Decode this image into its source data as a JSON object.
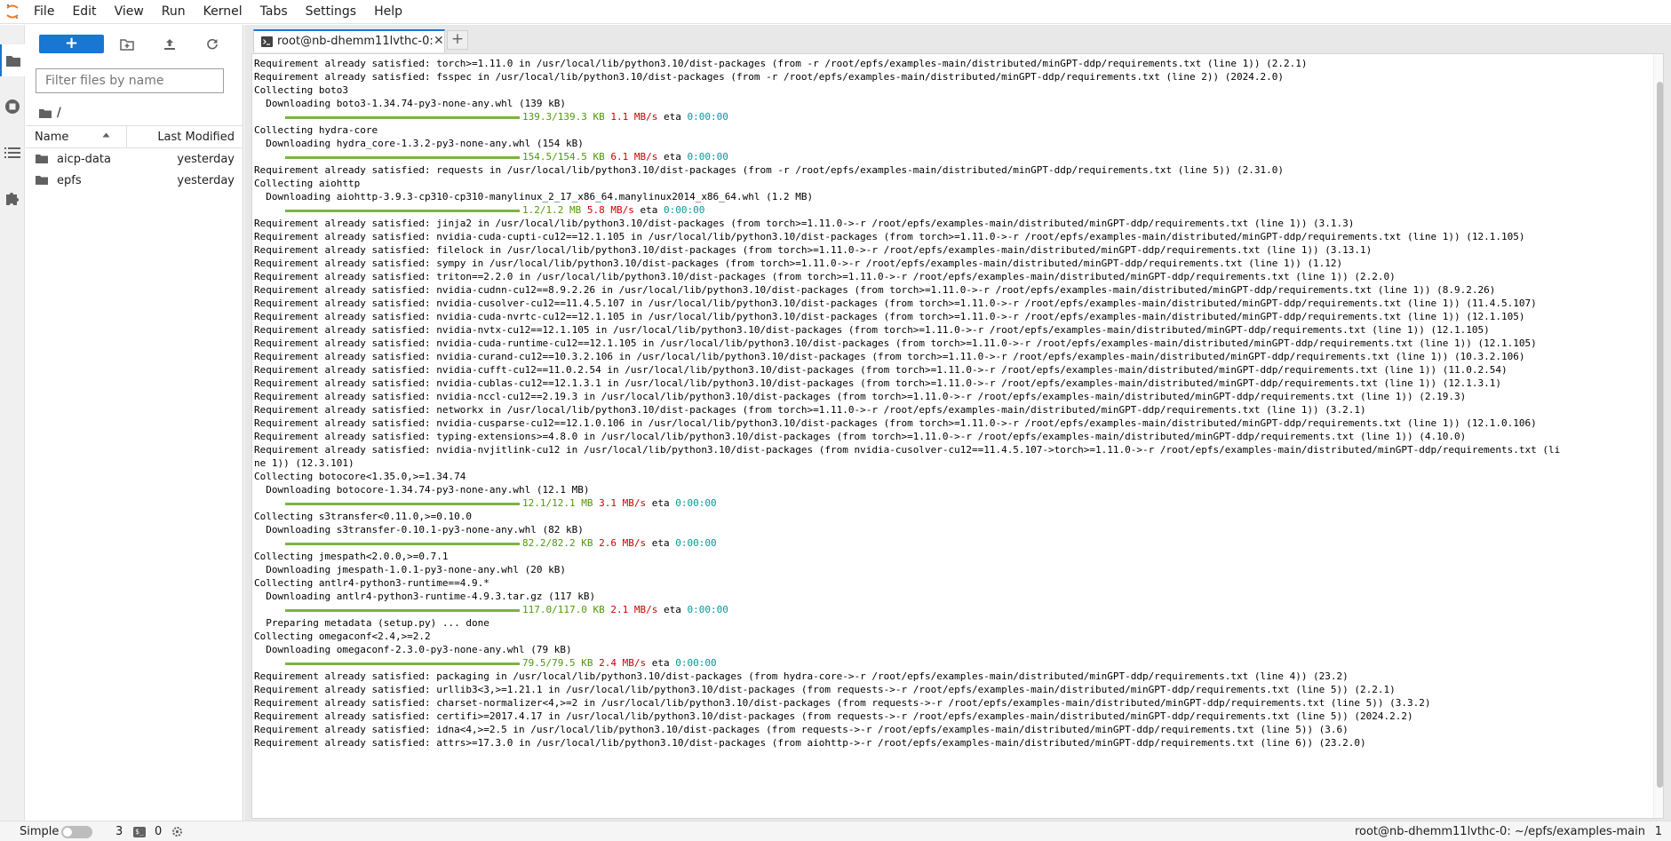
{
  "menu": [
    "File",
    "Edit",
    "View",
    "Run",
    "Kernel",
    "Tabs",
    "Settings",
    "Help"
  ],
  "sidebar": {
    "filter_placeholder": "Filter files by name",
    "breadcrumb": "/",
    "columns": {
      "name": "Name",
      "modified": "Last Modified"
    },
    "files": [
      {
        "name": "aicp-data",
        "modified": "yesterday"
      },
      {
        "name": "epfs",
        "modified": "yesterday"
      }
    ]
  },
  "tab": {
    "label": "root@nb-dhemm11lvthc-0:"
  },
  "terminal": {
    "lines": [
      {
        "text": "Requirement already satisfied: torch>=1.11.0 in /usr/local/lib/python3.10/dist-packages (from -r /root/epfs/examples-main/distributed/minGPT-ddp/requirements.txt (line 1)) (2.2.1)"
      },
      {
        "text": "Requirement already satisfied: fsspec in /usr/local/lib/python3.10/dist-packages (from -r /root/epfs/examples-main/distributed/minGPT-ddp/requirements.txt (line 2)) (2024.2.0)"
      },
      {
        "text": "Collecting boto3"
      },
      {
        "text": "  Downloading boto3-1.34.74-py3-none-any.whl (139 kB)"
      },
      {
        "progress": true,
        "done": "139.3/139.3 KB",
        "speed": "1.1 MB/s",
        "eta_label": "eta",
        "eta": "0:00:00"
      },
      {
        "text": "Collecting hydra-core"
      },
      {
        "text": "  Downloading hydra_core-1.3.2-py3-none-any.whl (154 kB)"
      },
      {
        "progress": true,
        "done": "154.5/154.5 KB",
        "speed": "6.1 MB/s",
        "eta_label": "eta",
        "eta": "0:00:00"
      },
      {
        "text": "Requirement already satisfied: requests in /usr/local/lib/python3.10/dist-packages (from -r /root/epfs/examples-main/distributed/minGPT-ddp/requirements.txt (line 5)) (2.31.0)"
      },
      {
        "text": "Collecting aiohttp"
      },
      {
        "text": "  Downloading aiohttp-3.9.3-cp310-cp310-manylinux_2_17_x86_64.manylinux2014_x86_64.whl (1.2 MB)"
      },
      {
        "progress": true,
        "done": "1.2/1.2 MB",
        "speed": "5.8 MB/s",
        "eta_label": "eta",
        "eta": "0:00:00"
      },
      {
        "text": "Requirement already satisfied: jinja2 in /usr/local/lib/python3.10/dist-packages (from torch>=1.11.0->-r /root/epfs/examples-main/distributed/minGPT-ddp/requirements.txt (line 1)) (3.1.3)"
      },
      {
        "text": "Requirement already satisfied: nvidia-cuda-cupti-cu12==12.1.105 in /usr/local/lib/python3.10/dist-packages (from torch>=1.11.0->-r /root/epfs/examples-main/distributed/minGPT-ddp/requirements.txt (line 1)) (12.1.105)"
      },
      {
        "text": "Requirement already satisfied: filelock in /usr/local/lib/python3.10/dist-packages (from torch>=1.11.0->-r /root/epfs/examples-main/distributed/minGPT-ddp/requirements.txt (line 1)) (3.13.1)"
      },
      {
        "text": "Requirement already satisfied: sympy in /usr/local/lib/python3.10/dist-packages (from torch>=1.11.0->-r /root/epfs/examples-main/distributed/minGPT-ddp/requirements.txt (line 1)) (1.12)"
      },
      {
        "text": "Requirement already satisfied: triton==2.2.0 in /usr/local/lib/python3.10/dist-packages (from torch>=1.11.0->-r /root/epfs/examples-main/distributed/minGPT-ddp/requirements.txt (line 1)) (2.2.0)"
      },
      {
        "text": "Requirement already satisfied: nvidia-cudnn-cu12==8.9.2.26 in /usr/local/lib/python3.10/dist-packages (from torch>=1.11.0->-r /root/epfs/examples-main/distributed/minGPT-ddp/requirements.txt (line 1)) (8.9.2.26)"
      },
      {
        "text": "Requirement already satisfied: nvidia-cusolver-cu12==11.4.5.107 in /usr/local/lib/python3.10/dist-packages (from torch>=1.11.0->-r /root/epfs/examples-main/distributed/minGPT-ddp/requirements.txt (line 1)) (11.4.5.107)"
      },
      {
        "text": "Requirement already satisfied: nvidia-cuda-nvrtc-cu12==12.1.105 in /usr/local/lib/python3.10/dist-packages (from torch>=1.11.0->-r /root/epfs/examples-main/distributed/minGPT-ddp/requirements.txt (line 1)) (12.1.105)"
      },
      {
        "text": "Requirement already satisfied: nvidia-nvtx-cu12==12.1.105 in /usr/local/lib/python3.10/dist-packages (from torch>=1.11.0->-r /root/epfs/examples-main/distributed/minGPT-ddp/requirements.txt (line 1)) (12.1.105)"
      },
      {
        "text": "Requirement already satisfied: nvidia-cuda-runtime-cu12==12.1.105 in /usr/local/lib/python3.10/dist-packages (from torch>=1.11.0->-r /root/epfs/examples-main/distributed/minGPT-ddp/requirements.txt (line 1)) (12.1.105)"
      },
      {
        "text": "Requirement already satisfied: nvidia-curand-cu12==10.3.2.106 in /usr/local/lib/python3.10/dist-packages (from torch>=1.11.0->-r /root/epfs/examples-main/distributed/minGPT-ddp/requirements.txt (line 1)) (10.3.2.106)"
      },
      {
        "text": "Requirement already satisfied: nvidia-cufft-cu12==11.0.2.54 in /usr/local/lib/python3.10/dist-packages (from torch>=1.11.0->-r /root/epfs/examples-main/distributed/minGPT-ddp/requirements.txt (line 1)) (11.0.2.54)"
      },
      {
        "text": "Requirement already satisfied: nvidia-cublas-cu12==12.1.3.1 in /usr/local/lib/python3.10/dist-packages (from torch>=1.11.0->-r /root/epfs/examples-main/distributed/minGPT-ddp/requirements.txt (line 1)) (12.1.3.1)"
      },
      {
        "text": "Requirement already satisfied: nvidia-nccl-cu12==2.19.3 in /usr/local/lib/python3.10/dist-packages (from torch>=1.11.0->-r /root/epfs/examples-main/distributed/minGPT-ddp/requirements.txt (line 1)) (2.19.3)"
      },
      {
        "text": "Requirement already satisfied: networkx in /usr/local/lib/python3.10/dist-packages (from torch>=1.11.0->-r /root/epfs/examples-main/distributed/minGPT-ddp/requirements.txt (line 1)) (3.2.1)"
      },
      {
        "text": "Requirement already satisfied: nvidia-cusparse-cu12==12.1.0.106 in /usr/local/lib/python3.10/dist-packages (from torch>=1.11.0->-r /root/epfs/examples-main/distributed/minGPT-ddp/requirements.txt (line 1)) (12.1.0.106)"
      },
      {
        "text": "Requirement already satisfied: typing-extensions>=4.8.0 in /usr/local/lib/python3.10/dist-packages (from torch>=1.11.0->-r /root/epfs/examples-main/distributed/minGPT-ddp/requirements.txt (line 1)) (4.10.0)"
      },
      {
        "text": "Requirement already satisfied: nvidia-nvjitlink-cu12 in /usr/local/lib/python3.10/dist-packages (from nvidia-cusolver-cu12==11.4.5.107->torch>=1.11.0->-r /root/epfs/examples-main/distributed/minGPT-ddp/requirements.txt (li"
      },
      {
        "text": "ne 1)) (12.3.101)"
      },
      {
        "text": "Collecting botocore<1.35.0,>=1.34.74"
      },
      {
        "text": "  Downloading botocore-1.34.74-py3-none-any.whl (12.1 MB)"
      },
      {
        "progress": true,
        "done": "12.1/12.1 MB",
        "speed": "3.1 MB/s",
        "eta_label": "eta",
        "eta": "0:00:00"
      },
      {
        "text": "Collecting s3transfer<0.11.0,>=0.10.0"
      },
      {
        "text": "  Downloading s3transfer-0.10.1-py3-none-any.whl (82 kB)"
      },
      {
        "progress": true,
        "done": "82.2/82.2 KB",
        "speed": "2.6 MB/s",
        "eta_label": "eta",
        "eta": "0:00:00"
      },
      {
        "text": "Collecting jmespath<2.0.0,>=0.7.1"
      },
      {
        "text": "  Downloading jmespath-1.0.1-py3-none-any.whl (20 kB)"
      },
      {
        "text": "Collecting antlr4-python3-runtime==4.9.*"
      },
      {
        "text": "  Downloading antlr4-python3-runtime-4.9.3.tar.gz (117 kB)"
      },
      {
        "progress": true,
        "done": "117.0/117.0 KB",
        "speed": "2.1 MB/s",
        "eta_label": "eta",
        "eta": "0:00:00"
      },
      {
        "text": "  Preparing metadata (setup.py) ... done"
      },
      {
        "text": "Collecting omegaconf<2.4,>=2.2"
      },
      {
        "text": "  Downloading omegaconf-2.3.0-py3-none-any.whl (79 kB)"
      },
      {
        "progress": true,
        "done": "79.5/79.5 KB",
        "speed": "2.4 MB/s",
        "eta_label": "eta",
        "eta": "0:00:00"
      },
      {
        "text": "Requirement already satisfied: packaging in /usr/local/lib/python3.10/dist-packages (from hydra-core->-r /root/epfs/examples-main/distributed/minGPT-ddp/requirements.txt (line 4)) (23.2)"
      },
      {
        "text": "Requirement already satisfied: urllib3<3,>=1.21.1 in /usr/local/lib/python3.10/dist-packages (from requests->-r /root/epfs/examples-main/distributed/minGPT-ddp/requirements.txt (line 5)) (2.2.1)"
      },
      {
        "text": "Requirement already satisfied: charset-normalizer<4,>=2 in /usr/local/lib/python3.10/dist-packages (from requests->-r /root/epfs/examples-main/distributed/minGPT-ddp/requirements.txt (line 5)) (3.3.2)"
      },
      {
        "text": "Requirement already satisfied: certifi>=2017.4.17 in /usr/local/lib/python3.10/dist-packages (from requests->-r /root/epfs/examples-main/distributed/minGPT-ddp/requirements.txt (line 5)) (2024.2.2)"
      },
      {
        "text": "Requirement already satisfied: idna<4,>=2.5 in /usr/local/lib/python3.10/dist-packages (from requests->-r /root/epfs/examples-main/distributed/minGPT-ddp/requirements.txt (line 5)) (3.6)"
      },
      {
        "text": "Requirement already satisfied: attrs>=17.3.0 in /usr/local/lib/python3.10/dist-packages (from aiohttp->-r /root/epfs/examples-main/distributed/minGPT-ddp/requirements.txt (line 6)) (23.2.0)"
      }
    ]
  },
  "statusbar": {
    "mode": "Simple",
    "simple_mode_on": false,
    "terminals": "3",
    "terminal_icon_text": "$_",
    "kernels": "0",
    "path": "root@nb-dhemm11lvthc-0: ~/epfs/examples-main",
    "line": "1"
  },
  "colors": {
    "accent": "#1976d2",
    "progress_bar": "#7cb342",
    "progress_done": "#4e9a06",
    "progress_speed": "#cc0000",
    "progress_eta": "#06989a",
    "folder_icon": "#616161"
  },
  "icons": {
    "logo": "jupyter-logo-icon",
    "activity": [
      "folder-icon",
      "stop-circle-icon",
      "list-icon",
      "puzzle-icon"
    ],
    "toolbar": [
      "plus-icon",
      "new-folder-icon",
      "upload-icon",
      "refresh-icon"
    ],
    "file": "folder-icon",
    "sort": "caret-up-icon",
    "tab": "terminal-icon",
    "close": "close-icon",
    "kernel_status": "gear-icon"
  }
}
